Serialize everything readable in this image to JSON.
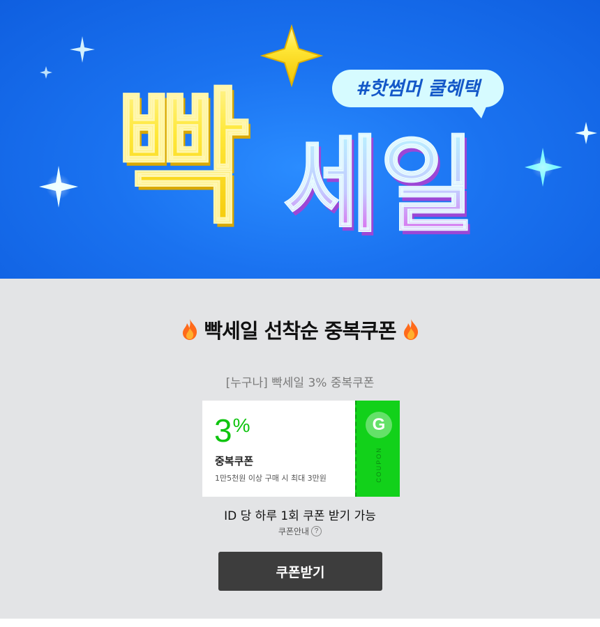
{
  "banner": {
    "hashtag": "#핫썸머 쿨혜택",
    "title_left": "빡",
    "title_right": "세일",
    "colors": {
      "background": "#1a72f0",
      "yellow": "#ffe83a",
      "pastel_top": "#a8f0ff",
      "pastel_bottom": "#e24fe8"
    }
  },
  "section": {
    "title": "빡세일 선착순 중복쿠폰",
    "subtitle": "[누구나] 빡세일 3% 중복쿠폰",
    "coupon": {
      "value": "3",
      "unit": "%",
      "name": "중복쿠폰",
      "condition": "1만5천원 이상 구매 시 최대 3만원",
      "logo_letter": "G",
      "side_text": "COUPON",
      "accent_color": "#12d11a"
    },
    "limit_text": "ID 당 하루 1회 쿠폰 받기 가능",
    "guide_label": "쿠폰안내",
    "help_symbol": "?",
    "cta_label": "쿠폰받기"
  }
}
